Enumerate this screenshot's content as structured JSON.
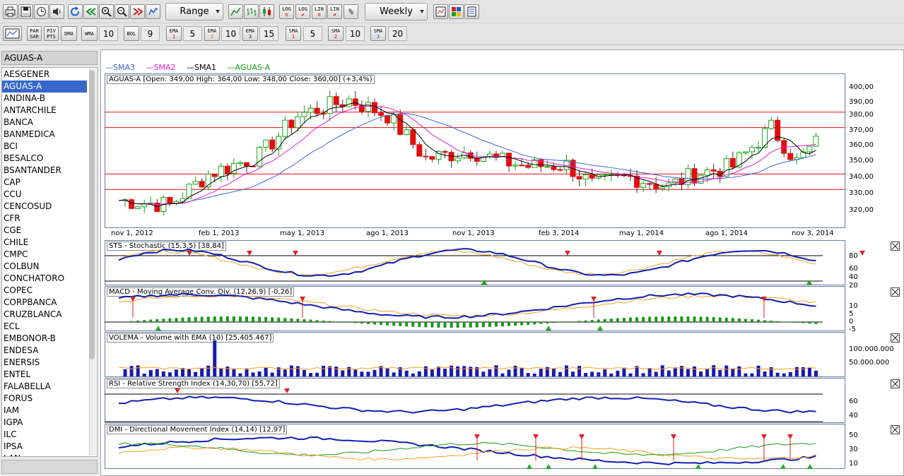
{
  "toolbar": {
    "icons": [
      "print-icon",
      "save-icon",
      "clock-icon",
      "speaker-icon",
      "refresh-icon",
      "rewind-icon",
      "zoom-in-icon",
      "zoom-out-icon",
      "fast-forward-icon",
      "replay-icon"
    ],
    "range_label": "Range",
    "chart_types": [
      "line-chart-icon",
      "bar-chart-icon",
      "candlestick-icon"
    ],
    "scales": [
      {
        "top": "LOG",
        "bottom": "≡"
      },
      {
        "top": "LOG",
        "bottom": "≠"
      },
      {
        "top": "LIN",
        "bottom": "≡"
      },
      {
        "top": "LIN",
        "bottom": "≠"
      },
      {
        "top": "%",
        "bottom": ""
      }
    ],
    "period_label": "Weekly",
    "tools": [
      "chart-settings-icon",
      "color-grid-icon",
      "report-icon"
    ]
  },
  "toolbar2": {
    "indicators": [
      {
        "top": "PAR",
        "bottom": "SAR"
      },
      {
        "top": "PIV",
        "bottom": "PTS"
      },
      {
        "top": "DMA",
        "bottom": ""
      }
    ],
    "wma_label": "WMA",
    "wma_value": "10",
    "bol_label": "BOL",
    "bol_value": "9",
    "ema": [
      {
        "top": "EMA",
        "sub": "1",
        "value": "5"
      },
      {
        "top": "EMA",
        "sub": "2",
        "value": "10"
      },
      {
        "top": "EMA",
        "sub": "3",
        "value": "15"
      }
    ],
    "sma": [
      {
        "top": "SMA",
        "sub": "1",
        "value": "5"
      },
      {
        "top": "SMA",
        "sub": "2",
        "value": "10"
      },
      {
        "top": "SMA",
        "sub": "3",
        "value": "20"
      }
    ]
  },
  "sidebar": {
    "header": "AGUAS-A",
    "items": [
      "AESGENER",
      "AGUAS-A",
      "ANDINA-B",
      "ANTARCHILE",
      "BANCA",
      "BANMEDICA",
      "BCI",
      "BESALCO",
      "BSANTANDER",
      "CAP",
      "CCU",
      "CENCOSUD",
      "CFR",
      "CGE",
      "CHILE",
      "CMPC",
      "COLBUN",
      "CONCHATORO",
      "COPEC",
      "CORPBANCA",
      "CRUZBLANCA",
      "ECL",
      "EMBONOR-B",
      "ENDESA",
      "ENERSIS",
      "ENTEL",
      "FALABELLA",
      "FORUS",
      "IAM",
      "IGPA",
      "ILC",
      "IPSA",
      "LAN"
    ],
    "selected": "AGUAS-A"
  },
  "legend": [
    {
      "label": "SMA3",
      "color": "#3f63d8"
    },
    {
      "label": "SMA2",
      "color": "#e01cd0"
    },
    {
      "label": "SMA1",
      "color": "#000000"
    },
    {
      "label": "AGUAS-A",
      "color": "#1a9a1a"
    }
  ],
  "price_panel": {
    "title": "AGUAS-A [Open: 349,00  High: 364,00  Low: 348,00  Close: 360,00] (+3,4%)",
    "yticks": [
      "400,00",
      "390,00",
      "380,00",
      "370,00",
      "360,00",
      "350,00",
      "340,00",
      "330,00",
      "320,00"
    ],
    "xticks": [
      "nov 1, 2012",
      "feb 1, 2013",
      "may 1, 2013",
      "ago 1, 2013",
      "nov 1, 2013",
      "feb 3, 2014",
      "may 1, 2014",
      "ago 1, 2014",
      "nov 3, 2014"
    ]
  },
  "panels": {
    "sts": {
      "title": "STS - Stochastic (15,3,5) [38,84]",
      "yticks": [
        "80",
        "60",
        "40",
        "20"
      ]
    },
    "macd": {
      "title": "MACD - Moving Average Conv. Div. (12,26,9) [-0,26]",
      "yticks": [
        "10",
        "5",
        "0",
        "-5"
      ]
    },
    "volema": {
      "title": "VOLEMA - Volume with EMA (10) [25.405.467]",
      "yticks": [
        "100.000.000",
        "50.000.000"
      ]
    },
    "rsi": {
      "title": "RSI - Relative Strength Index (14,30,70) [55,72]",
      "yticks": [
        "60",
        "40"
      ]
    },
    "dmi": {
      "title": "DMI - Directional Movement Index (14,14) [12,97]",
      "yticks": [
        "50",
        "30",
        "10"
      ]
    }
  },
  "colors": {
    "up": "#19a619",
    "down": "#e01010",
    "signal_up": "#1fae1f",
    "signal_down": "#e02020",
    "osc_main": "#1020b0",
    "osc_signal": "#f0a020",
    "support_line": "#e01010"
  }
}
